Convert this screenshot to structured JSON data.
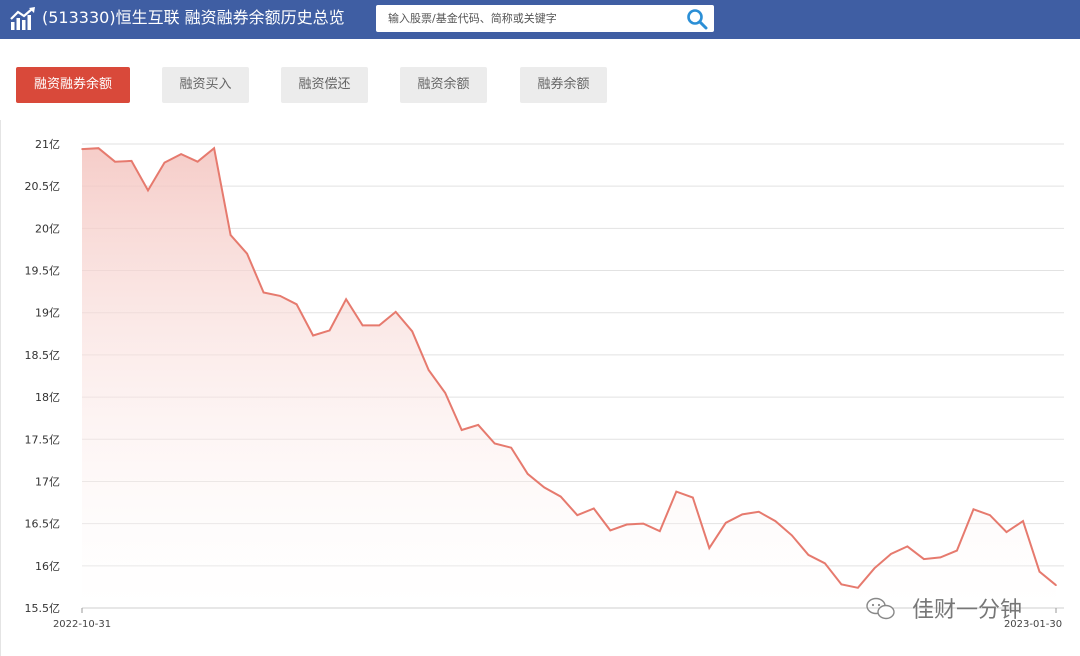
{
  "header": {
    "title": "(513330)恒生互联 融资融券余额历史总览",
    "search_placeholder": "输入股票/基金代码、简称或关键字",
    "logo_icon": "bar-chart-trend-icon",
    "search_icon": "magnifier-icon"
  },
  "tabs": [
    {
      "label": "融资融券余额",
      "active": true
    },
    {
      "label": "融资买入",
      "active": false
    },
    {
      "label": "融资偿还",
      "active": false
    },
    {
      "label": "融资余额",
      "active": false
    },
    {
      "label": "融券余额",
      "active": false
    }
  ],
  "colors": {
    "header_bg": "#3f5ea3",
    "active_tab": "#d9493a",
    "line": "#e67a6e",
    "fill": "#f7d6d2"
  },
  "watermark": "佳财一分钟",
  "chart_data": {
    "type": "area",
    "ylim": [
      15.5,
      21
    ],
    "y_ticks": [
      "21亿",
      "20.5亿",
      "20亿",
      "19.5亿",
      "19亿",
      "18.5亿",
      "18亿",
      "17.5亿",
      "17亿",
      "16.5亿",
      "16亿",
      "15.5亿"
    ],
    "x_tick_labels": [
      "2022-10-31",
      "2023-01-30"
    ],
    "grid": true,
    "series": [
      {
        "values": [
          20.94,
          20.95,
          20.79,
          20.8,
          20.45,
          20.78,
          20.88,
          20.79,
          20.95,
          19.92,
          19.7,
          19.24,
          19.2,
          19.1,
          18.73,
          18.79,
          19.16,
          18.85,
          18.85,
          19.01,
          18.78,
          18.32,
          18.05,
          17.61,
          17.67,
          17.45,
          17.4,
          17.09,
          16.93,
          16.82,
          16.6,
          16.68,
          16.42,
          16.49,
          16.5,
          16.41,
          16.88,
          16.81,
          16.21,
          16.51,
          16.61,
          16.64,
          16.53,
          16.36,
          16.13,
          16.03,
          15.78,
          15.74,
          15.97,
          16.14,
          16.23,
          16.08,
          16.1,
          16.18,
          16.67,
          16.6,
          16.4,
          16.53,
          15.93,
          15.77
        ]
      }
    ]
  }
}
